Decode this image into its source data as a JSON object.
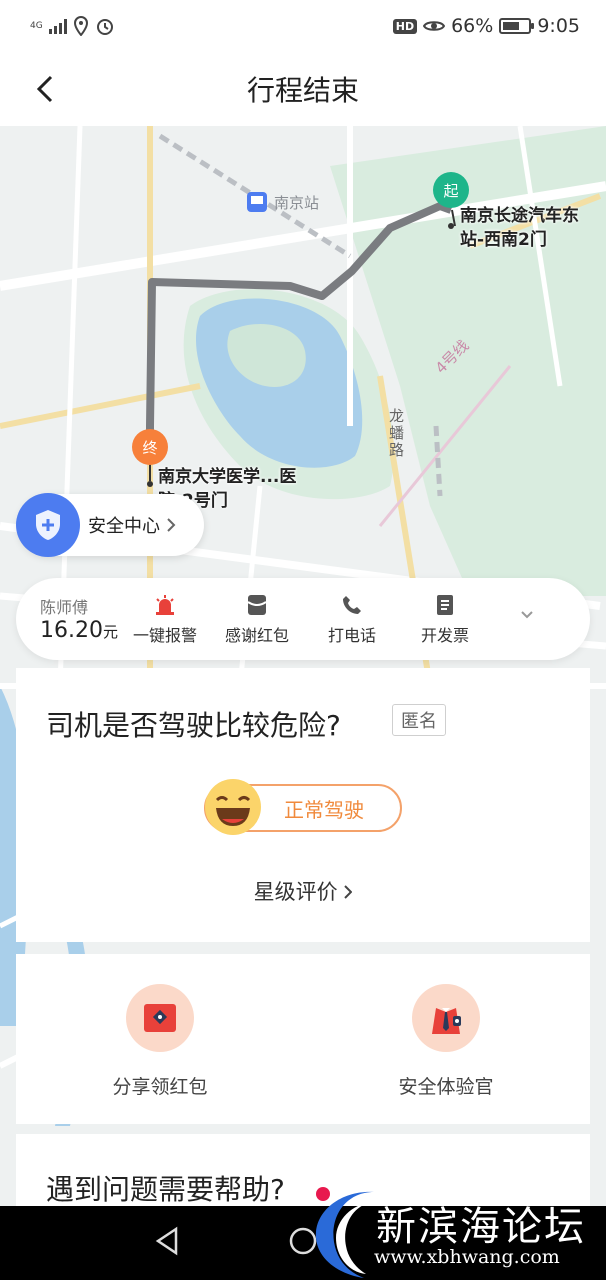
{
  "status_bar": {
    "network": "4G",
    "battery": "66%",
    "time": "9:05",
    "hd": "HD"
  },
  "header": {
    "title": "行程结束"
  },
  "map": {
    "start_label": "南京长途汽车东站-西南2门",
    "start_pin": "起",
    "end_label": "南京大学医学...医院-2号门",
    "end_pin": "终",
    "station_label": "南京站",
    "road_label_1": "龙蟠路",
    "road_label_2": "4号线"
  },
  "safety_center": {
    "label": "安全中心"
  },
  "driver": {
    "name": "陈师傅",
    "fare": "16.20",
    "fare_unit": "元",
    "actions": [
      {
        "label": "一键报警",
        "icon": "alarm-icon"
      },
      {
        "label": "感谢红包",
        "icon": "red-envelope-icon"
      },
      {
        "label": "打电话",
        "icon": "phone-icon"
      },
      {
        "label": "开发票",
        "icon": "invoice-icon"
      }
    ]
  },
  "rating": {
    "question": "司机是否驾驶比较危险?",
    "anonymous_tag": "匿名",
    "normal_label": "正常驾驶",
    "star_link": "星级评价"
  },
  "promos": [
    {
      "label": "分享领红包",
      "icon": "share-envelope-icon"
    },
    {
      "label": "安全体验官",
      "icon": "safety-officer-icon"
    }
  ],
  "help": {
    "title": "遇到问题需要帮助?"
  },
  "watermark": {
    "name": "新滨海论坛",
    "url": "www.xbhwang.com"
  },
  "colors": {
    "start_pin": "#1eb58a",
    "end_pin": "#f7803a",
    "safety_blue": "#4d7cf0",
    "accent_orange": "#f08a3c",
    "alarm_red": "#e8413a"
  }
}
